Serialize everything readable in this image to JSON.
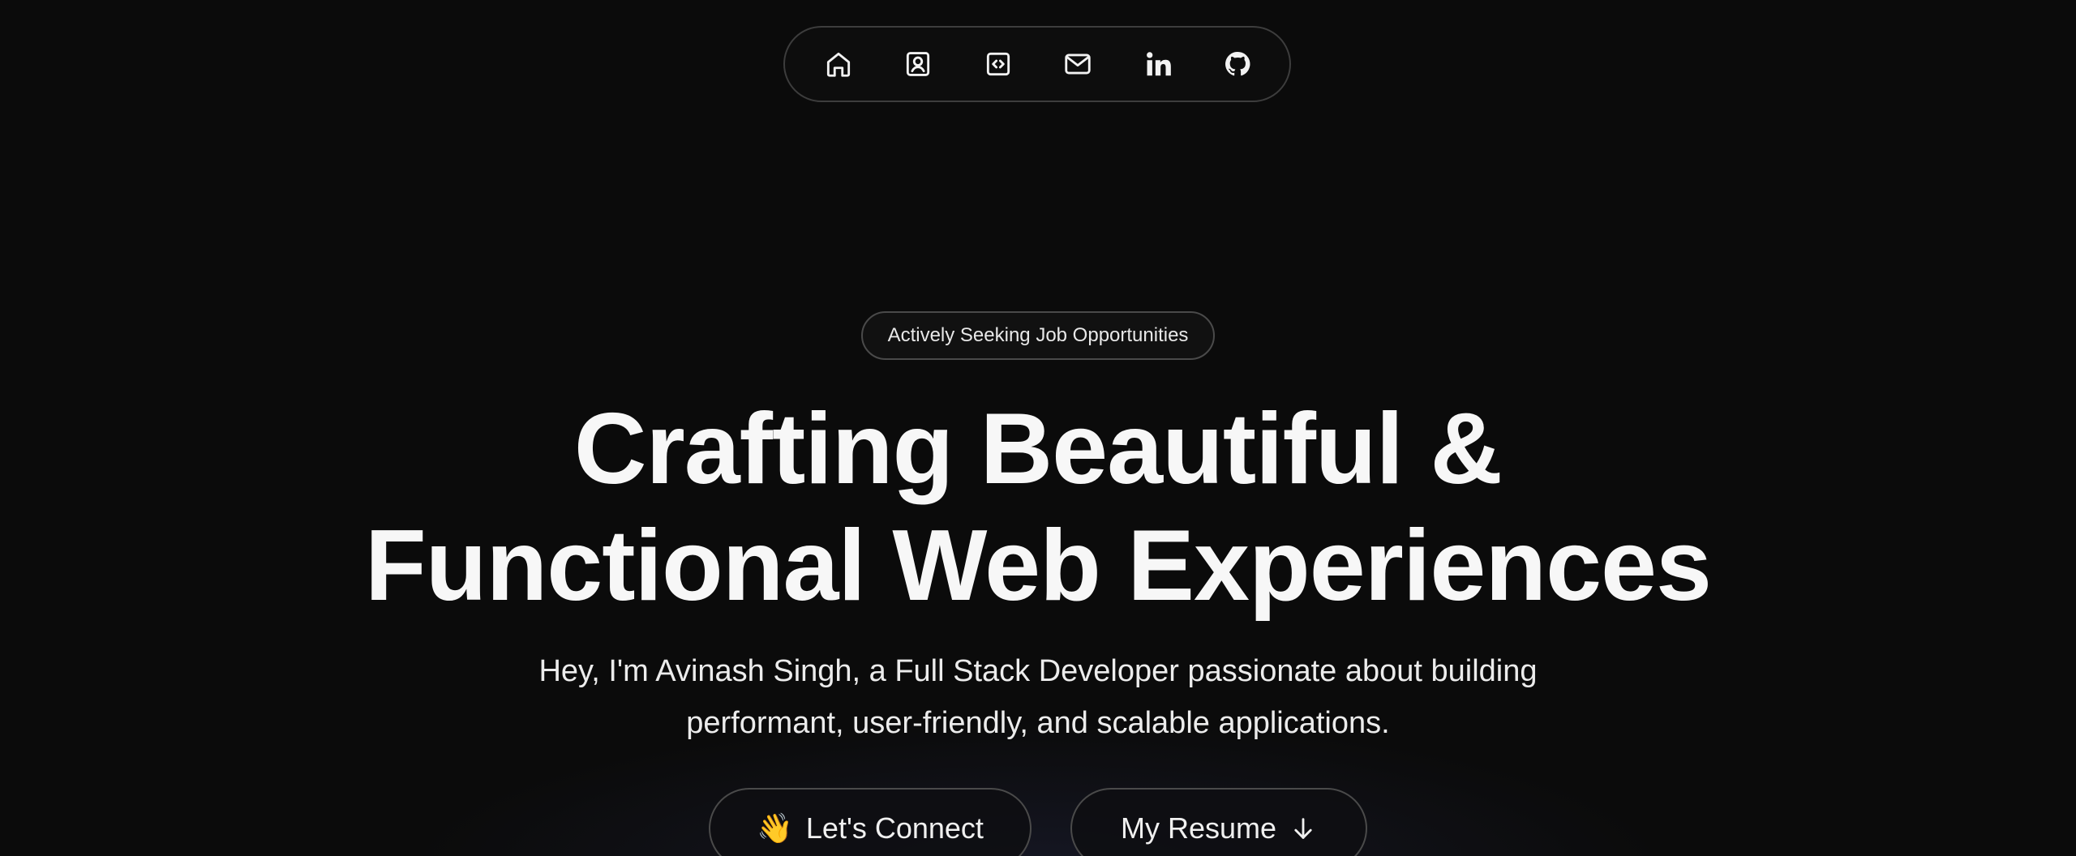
{
  "nav": {
    "items": [
      {
        "name": "home",
        "icon": "home-icon"
      },
      {
        "name": "about",
        "icon": "user-card-icon"
      },
      {
        "name": "projects",
        "icon": "code-icon"
      },
      {
        "name": "contact",
        "icon": "mail-icon"
      },
      {
        "name": "linkedin",
        "icon": "linkedin-icon"
      },
      {
        "name": "github",
        "icon": "github-icon"
      }
    ]
  },
  "hero": {
    "badge": "Actively Seeking Job Opportunities",
    "headline_line1": "Crafting Beautiful &",
    "headline_line2": "Functional Web Experiences",
    "subtitle_line1": "Hey, I'm Avinash Singh, a Full Stack Developer passionate about building",
    "subtitle_line2": "performant, user-friendly, and scalable applications.",
    "connect_emoji": "👋",
    "connect_label": "Let's Connect",
    "resume_label": "My Resume",
    "resume_icon": "arrow-down-icon"
  },
  "colors": {
    "background": "#0b0b0b",
    "text": "#f2f2f2",
    "border": "#3d3d3d"
  }
}
